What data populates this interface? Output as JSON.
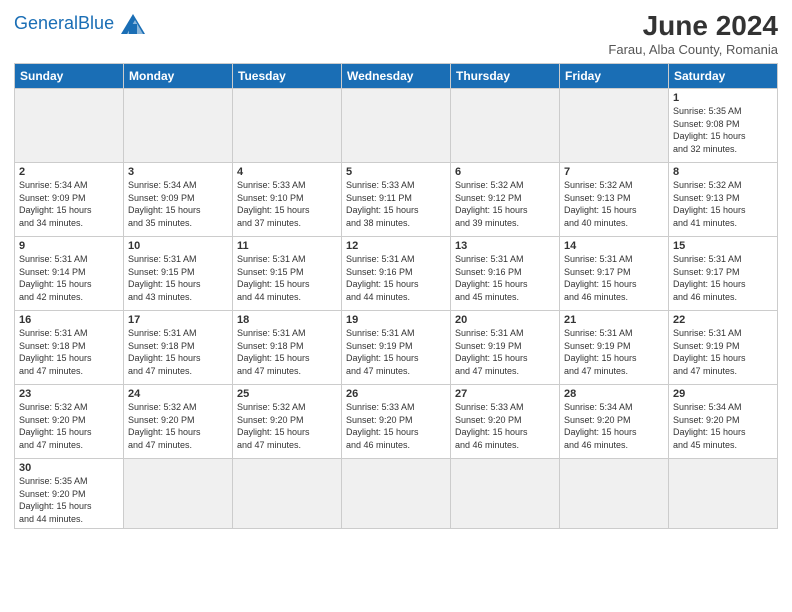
{
  "header": {
    "logo_general": "General",
    "logo_blue": "Blue",
    "month_title": "June 2024",
    "subtitle": "Farau, Alba County, Romania"
  },
  "weekdays": [
    "Sunday",
    "Monday",
    "Tuesday",
    "Wednesday",
    "Thursday",
    "Friday",
    "Saturday"
  ],
  "weeks": [
    [
      {
        "day": "",
        "empty": true
      },
      {
        "day": "",
        "empty": true
      },
      {
        "day": "",
        "empty": true
      },
      {
        "day": "",
        "empty": true
      },
      {
        "day": "",
        "empty": true
      },
      {
        "day": "",
        "empty": true
      },
      {
        "day": "1",
        "info": "Sunrise: 5:35 AM\nSunset: 9:08 PM\nDaylight: 15 hours\nand 32 minutes."
      }
    ],
    [
      {
        "day": "2",
        "info": "Sunrise: 5:34 AM\nSunset: 9:09 PM\nDaylight: 15 hours\nand 34 minutes."
      },
      {
        "day": "3",
        "info": "Sunrise: 5:34 AM\nSunset: 9:09 PM\nDaylight: 15 hours\nand 35 minutes."
      },
      {
        "day": "4",
        "info": "Sunrise: 5:33 AM\nSunset: 9:10 PM\nDaylight: 15 hours\nand 37 minutes."
      },
      {
        "day": "5",
        "info": "Sunrise: 5:33 AM\nSunset: 9:11 PM\nDaylight: 15 hours\nand 38 minutes."
      },
      {
        "day": "6",
        "info": "Sunrise: 5:32 AM\nSunset: 9:12 PM\nDaylight: 15 hours\nand 39 minutes."
      },
      {
        "day": "7",
        "info": "Sunrise: 5:32 AM\nSunset: 9:13 PM\nDaylight: 15 hours\nand 40 minutes."
      },
      {
        "day": "8",
        "info": "Sunrise: 5:32 AM\nSunset: 9:13 PM\nDaylight: 15 hours\nand 41 minutes."
      }
    ],
    [
      {
        "day": "9",
        "info": "Sunrise: 5:31 AM\nSunset: 9:14 PM\nDaylight: 15 hours\nand 42 minutes."
      },
      {
        "day": "10",
        "info": "Sunrise: 5:31 AM\nSunset: 9:15 PM\nDaylight: 15 hours\nand 43 minutes."
      },
      {
        "day": "11",
        "info": "Sunrise: 5:31 AM\nSunset: 9:15 PM\nDaylight: 15 hours\nand 44 minutes."
      },
      {
        "day": "12",
        "info": "Sunrise: 5:31 AM\nSunset: 9:16 PM\nDaylight: 15 hours\nand 44 minutes."
      },
      {
        "day": "13",
        "info": "Sunrise: 5:31 AM\nSunset: 9:16 PM\nDaylight: 15 hours\nand 45 minutes."
      },
      {
        "day": "14",
        "info": "Sunrise: 5:31 AM\nSunset: 9:17 PM\nDaylight: 15 hours\nand 46 minutes."
      },
      {
        "day": "15",
        "info": "Sunrise: 5:31 AM\nSunset: 9:17 PM\nDaylight: 15 hours\nand 46 minutes."
      }
    ],
    [
      {
        "day": "16",
        "info": "Sunrise: 5:31 AM\nSunset: 9:18 PM\nDaylight: 15 hours\nand 47 minutes."
      },
      {
        "day": "17",
        "info": "Sunrise: 5:31 AM\nSunset: 9:18 PM\nDaylight: 15 hours\nand 47 minutes."
      },
      {
        "day": "18",
        "info": "Sunrise: 5:31 AM\nSunset: 9:18 PM\nDaylight: 15 hours\nand 47 minutes."
      },
      {
        "day": "19",
        "info": "Sunrise: 5:31 AM\nSunset: 9:19 PM\nDaylight: 15 hours\nand 47 minutes."
      },
      {
        "day": "20",
        "info": "Sunrise: 5:31 AM\nSunset: 9:19 PM\nDaylight: 15 hours\nand 47 minutes."
      },
      {
        "day": "21",
        "info": "Sunrise: 5:31 AM\nSunset: 9:19 PM\nDaylight: 15 hours\nand 47 minutes."
      },
      {
        "day": "22",
        "info": "Sunrise: 5:31 AM\nSunset: 9:19 PM\nDaylight: 15 hours\nand 47 minutes."
      }
    ],
    [
      {
        "day": "23",
        "info": "Sunrise: 5:32 AM\nSunset: 9:20 PM\nDaylight: 15 hours\nand 47 minutes."
      },
      {
        "day": "24",
        "info": "Sunrise: 5:32 AM\nSunset: 9:20 PM\nDaylight: 15 hours\nand 47 minutes."
      },
      {
        "day": "25",
        "info": "Sunrise: 5:32 AM\nSunset: 9:20 PM\nDaylight: 15 hours\nand 47 minutes."
      },
      {
        "day": "26",
        "info": "Sunrise: 5:33 AM\nSunset: 9:20 PM\nDaylight: 15 hours\nand 46 minutes."
      },
      {
        "day": "27",
        "info": "Sunrise: 5:33 AM\nSunset: 9:20 PM\nDaylight: 15 hours\nand 46 minutes."
      },
      {
        "day": "28",
        "info": "Sunrise: 5:34 AM\nSunset: 9:20 PM\nDaylight: 15 hours\nand 46 minutes."
      },
      {
        "day": "29",
        "info": "Sunrise: 5:34 AM\nSunset: 9:20 PM\nDaylight: 15 hours\nand 45 minutes."
      }
    ],
    [
      {
        "day": "30",
        "info": "Sunrise: 5:35 AM\nSunset: 9:20 PM\nDaylight: 15 hours\nand 44 minutes.",
        "last": true
      },
      {
        "day": "",
        "empty": true,
        "last": true
      },
      {
        "day": "",
        "empty": true,
        "last": true
      },
      {
        "day": "",
        "empty": true,
        "last": true
      },
      {
        "day": "",
        "empty": true,
        "last": true
      },
      {
        "day": "",
        "empty": true,
        "last": true
      },
      {
        "day": "",
        "empty": true,
        "last": true
      }
    ]
  ]
}
